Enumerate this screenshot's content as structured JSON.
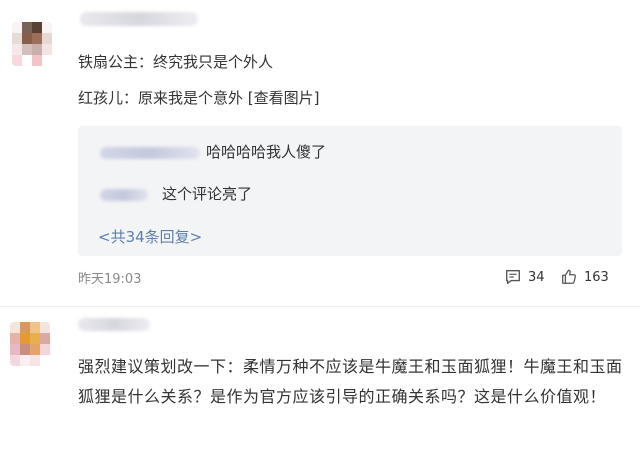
{
  "comment1": {
    "lines": [
      "铁扇公主：终究我只是个外人",
      "红孩儿：原来我是个意外 [查看图片]"
    ],
    "replies": [
      {
        "text": "哈哈哈哈我人傻了"
      },
      {
        "text": "这个评论亮了"
      }
    ],
    "more_replies": "<共34条回复>",
    "time": "昨天19:03",
    "comment_count": "34",
    "like_count": "163"
  },
  "comment2": {
    "text": "强烈建议策划改一下：柔情万种不应该是牛魔王和玉面狐狸！牛魔王和玉面狐狸是什么关系？是作为官方应该引导的正确关系吗？这是什么价值观！"
  },
  "icons": {
    "comment": "comment-icon",
    "like": "thumbs-up-icon"
  }
}
